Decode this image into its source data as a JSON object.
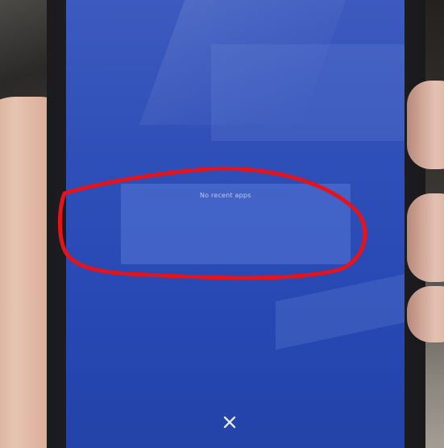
{
  "recents": {
    "empty_message": "No recent apps"
  },
  "controls": {
    "dismiss_icon": "close-icon"
  },
  "colors": {
    "screen_blue": "#2f4fb8",
    "annotation_red": "#e3141b"
  }
}
